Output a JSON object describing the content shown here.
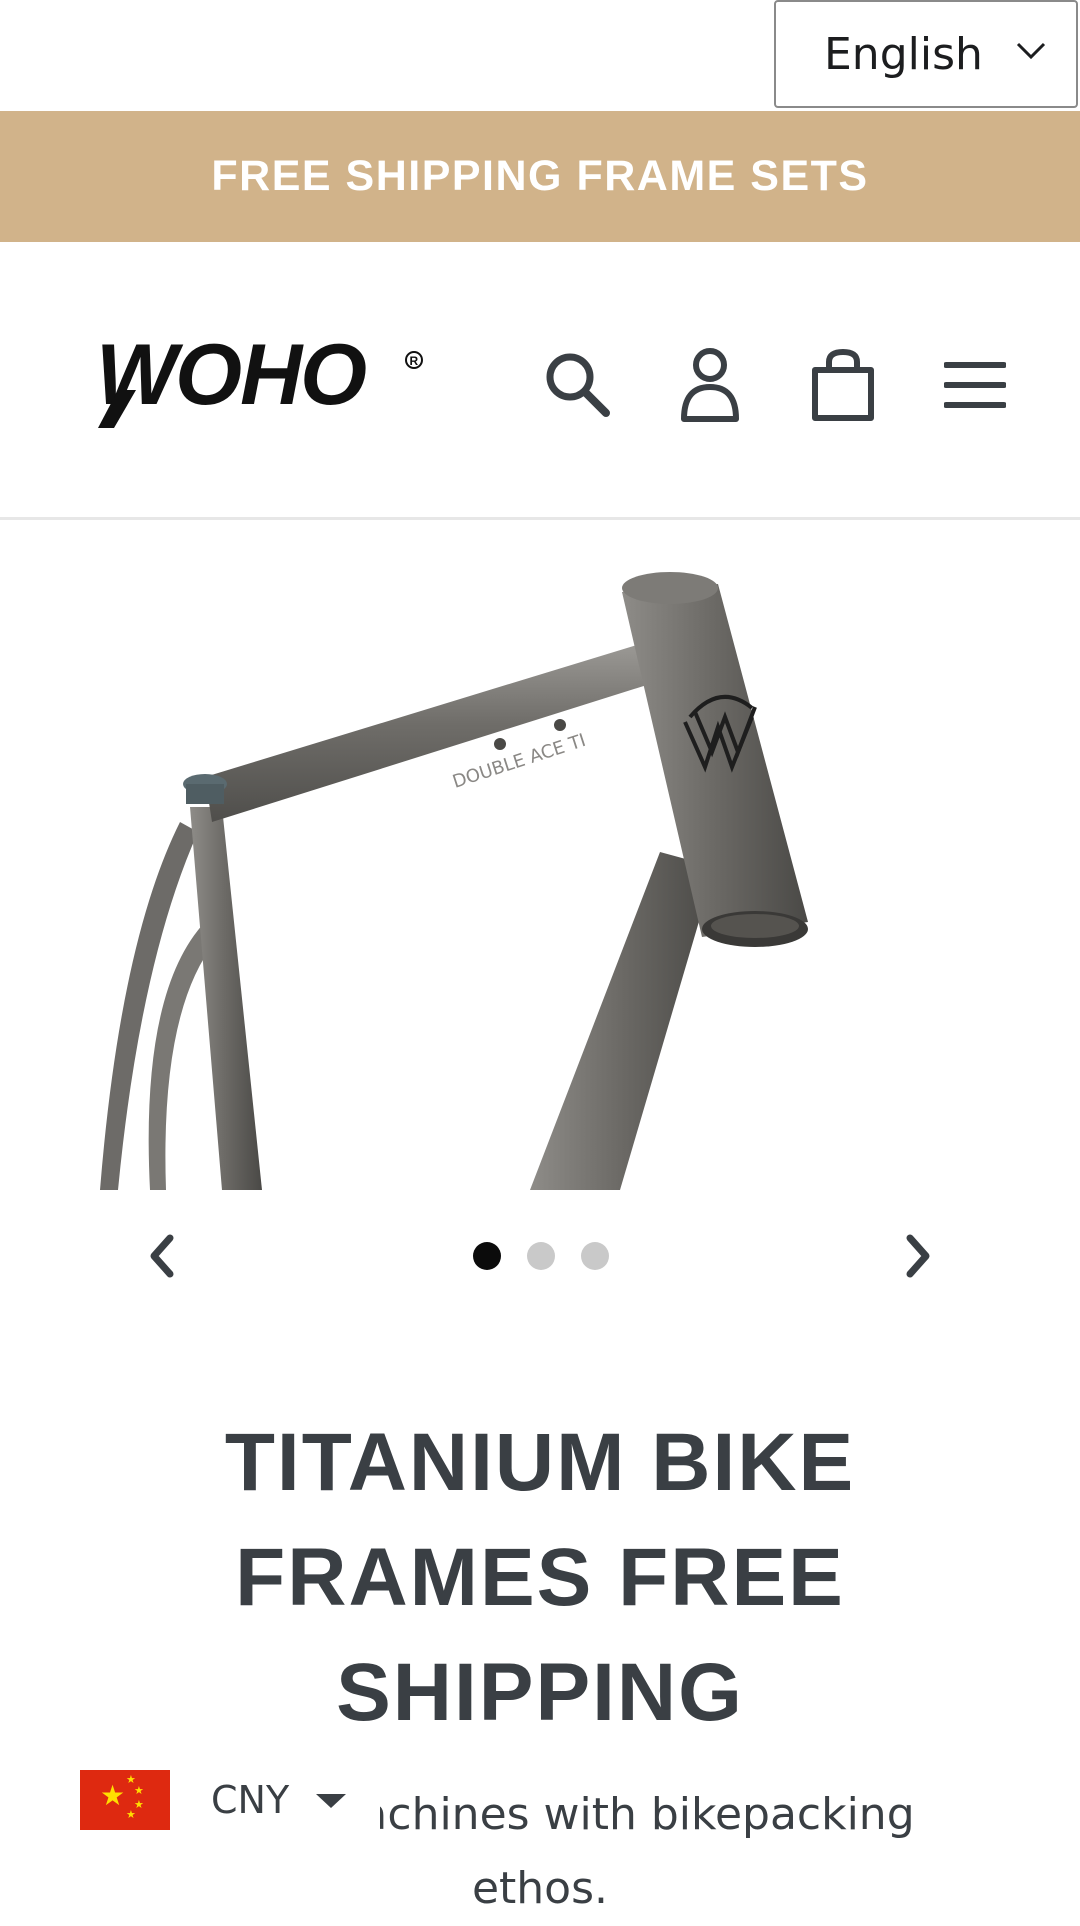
{
  "language_selector": {
    "value": "English"
  },
  "promo_banner": {
    "text": "FREE SHIPPING FRAME SETS"
  },
  "header": {
    "logo_text": "WOHO",
    "icons": [
      "search-icon",
      "account-icon",
      "cart-icon",
      "menu-icon"
    ]
  },
  "slideshow": {
    "slides": [
      "slide-1",
      "slide-2",
      "slide-3"
    ],
    "active_index": 0
  },
  "product": {
    "title": "TITANIUM BIKE FRAMES FREE SHIPPING",
    "description": "n race machines with bikepacking ethos."
  },
  "currency": {
    "code": "CNY"
  },
  "colors": {
    "accent": "#d1b38a",
    "text": "#3a3f44",
    "dot_active": "#0b0b0b",
    "dot_inactive": "#c9c9c9"
  }
}
